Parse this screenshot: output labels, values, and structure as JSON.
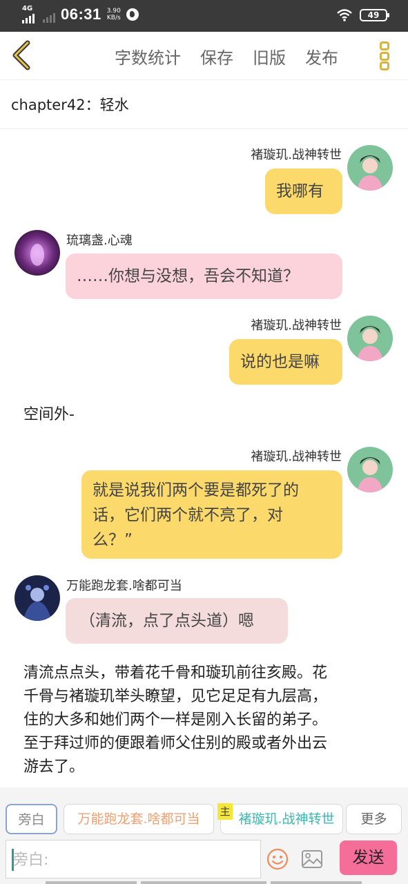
{
  "status_bar": {
    "network": "4G",
    "time": "06:31",
    "speed_value": "3.90",
    "speed_unit": "KB/s",
    "battery": "49"
  },
  "toolbar": {
    "word_count": "字数统计",
    "save": "保存",
    "old_version": "旧版",
    "publish": "发布"
  },
  "chapter_title": "chapter42：轻水",
  "messages": [
    {
      "speaker": "褚璇玑.战神转世",
      "text": "我哪有"
    },
    {
      "speaker": "琉璃盏.心魂",
      "text": "……你想与没想，吾会不知道？"
    },
    {
      "speaker": "褚璇玑.战神转世",
      "text": "说的也是嘛"
    },
    {
      "narration": "空间外-"
    },
    {
      "speaker": "褚璇玑.战神转世",
      "text_lines": [
        "就是说我们两个要是都死了的",
        "话，它们两个就不亮了，对",
        "么？”"
      ]
    },
    {
      "speaker": "万能跑龙套.啥都可当",
      "text": "（清流，点了点头道）嗯"
    },
    {
      "narration_lines": [
        "清流点点头，带着花千骨和璇玑前往亥殿。花",
        "千骨与褚璇玑举头瞭望，见它足足有九层高，",
        "住的大多和她们两个一样是刚入长留的弟子。",
        "至于拜过师的便跟着师父住别的殿或者外出云",
        "游去了。"
      ]
    }
  ],
  "role_selector": {
    "narrator": "旁白",
    "role1": "万能跑龙套.啥都可当",
    "main_badge": "主",
    "role2": "褚璇玑.战神转世",
    "more": "更多"
  },
  "composer": {
    "placeholder": "旁白:",
    "send": "发送"
  },
  "colors": {
    "accent_gold": "#d9b43c",
    "bubble_yellow": "#fcd96b",
    "bubble_pink": "#fcd3da",
    "send_pink": "#f56e9a"
  },
  "icons": [
    "back-chevron-icon",
    "more-dots-icon",
    "emoji-icon",
    "image-icon",
    "wifi-icon",
    "globe-icon"
  ]
}
